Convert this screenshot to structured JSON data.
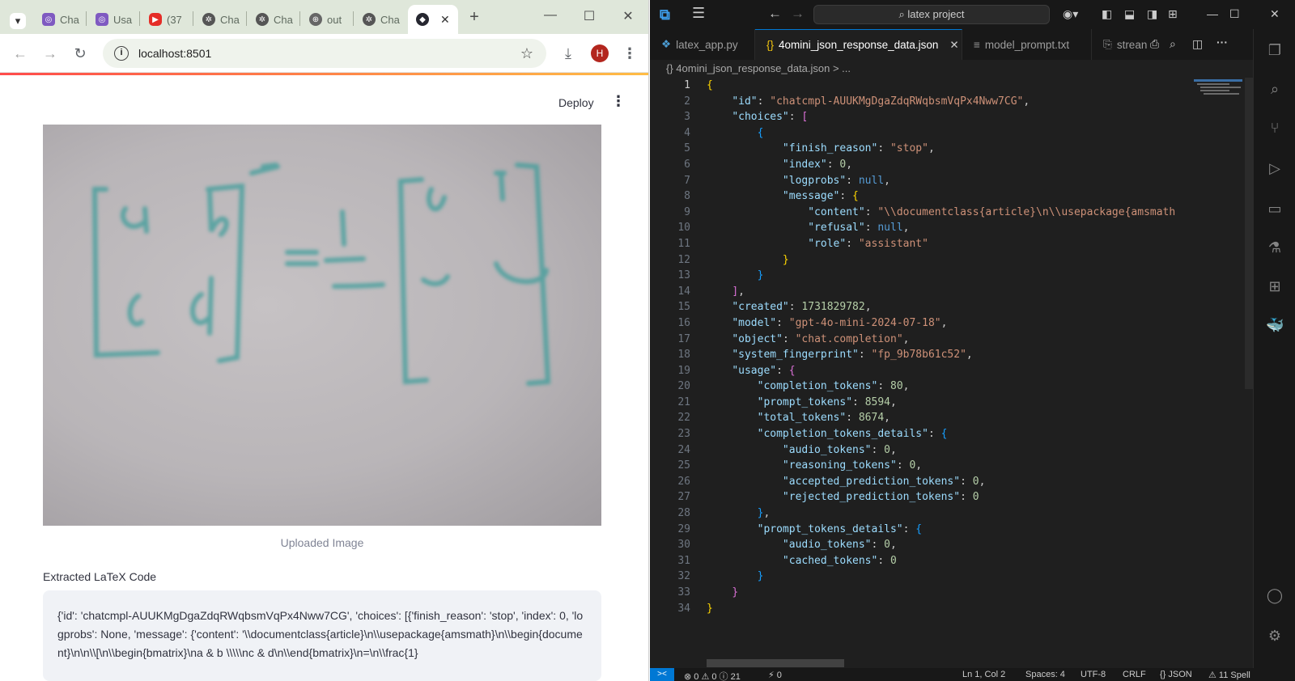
{
  "browser": {
    "tabs": [
      {
        "label": "Cha",
        "icon": "chatgpt-icon"
      },
      {
        "label": "Usa",
        "icon": "chatgpt-icon"
      },
      {
        "label": "(37",
        "icon": "youtube-icon"
      },
      {
        "label": "Cha",
        "icon": "openai-icon"
      },
      {
        "label": "Cha",
        "icon": "openai-icon"
      },
      {
        "label": "out",
        "icon": "globe-icon"
      },
      {
        "label": "Cha",
        "icon": "openai-icon"
      },
      {
        "label": "",
        "icon": "streamlit-icon",
        "active": true
      }
    ],
    "new_tab": "+",
    "url": "localhost:8501",
    "profile_initial": "H",
    "colors": {
      "tabstrip": "#dfe7da",
      "accent": "#ff4b4b",
      "avatar": "#b3261e"
    }
  },
  "app": {
    "deploy_label": "Deploy",
    "image_caption": "Uploaded Image",
    "latex_label": "Extracted LaTeX Code",
    "latex_code_text": "{'id': 'chatcmpl-AUUKMgDgaZdqRWqbsmVqPx4Nww7CG', 'choices': [{'finish_reason': 'stop', 'index': 0, 'logprobs': None, 'message': {'content': '\\\\documentclass{article}\\n\\\\usepackage{amsmath}\\n\\\\begin{document}\\n\\n\\\\[\\n\\\\begin{bmatrix}\\na & b \\\\\\\\\\nc & d\\n\\\\end{bmatrix}\\n=\\n\\\\frac{1}"
  },
  "vscode": {
    "search_text": "latex project",
    "tabs": [
      {
        "label": "latex_app.py",
        "icon": "python-icon"
      },
      {
        "label": "4omini_json_response_data.json",
        "icon": "json-icon",
        "active": true
      },
      {
        "label": "model_prompt.txt",
        "icon": "text-file-icon"
      },
      {
        "label": "strean",
        "icon": "preview-icon"
      }
    ],
    "breadcrumb": "{} 4omini_json_response_data.json > ...",
    "line_numbers": [
      "1",
      "2",
      "3",
      "4",
      "5",
      "6",
      "7",
      "8",
      "9",
      "10",
      "11",
      "12",
      "13",
      "14",
      "15",
      "16",
      "17",
      "18",
      "19",
      "20",
      "21",
      "22",
      "23",
      "24",
      "25",
      "26",
      "27",
      "28",
      "29",
      "30",
      "31",
      "32",
      "33",
      "34"
    ],
    "code": {
      "id": "\"chatcmpl-AUUKMgDgaZdqRWqbsmVqPx4Nww7CG\"",
      "finish_reason": "\"stop\"",
      "index": "0",
      "logprobs": "null",
      "content": "\"\\\\documentclass{article}\\n\\\\usepackage{amsmath",
      "refusal": "null",
      "role": "\"assistant\"",
      "created": "1731829782",
      "model": "\"gpt-4o-mini-2024-07-18\"",
      "object": "\"chat.completion\"",
      "system_fingerprint": "\"fp_9b78b61c52\"",
      "completion_tokens": "80",
      "prompt_tokens": "8594",
      "total_tokens": "8674",
      "audio_tokens": "0",
      "reasoning_tokens": "0",
      "accepted_prediction_tokens": "0",
      "rejected_prediction_tokens": "0",
      "audio_tokens_2": "0",
      "cached_tokens": "0"
    },
    "status": {
      "remote": "><",
      "problems": "⊗ 0 ⚠ 0 ⓘ 21",
      "ports": "⚡ 0",
      "position": "Ln 1, Col 2",
      "spaces": "Spaces: 4",
      "encoding": "UTF-8",
      "eol": "CRLF",
      "language": "{} JSON",
      "spell": "⚠ 11 Spell"
    },
    "colors": {
      "background": "#1f1f1f",
      "key": "#9cdcfe",
      "string": "#ce9178",
      "number": "#b5cea8",
      "keyword": "#569cd6",
      "status_accent": "#0078d4"
    }
  }
}
